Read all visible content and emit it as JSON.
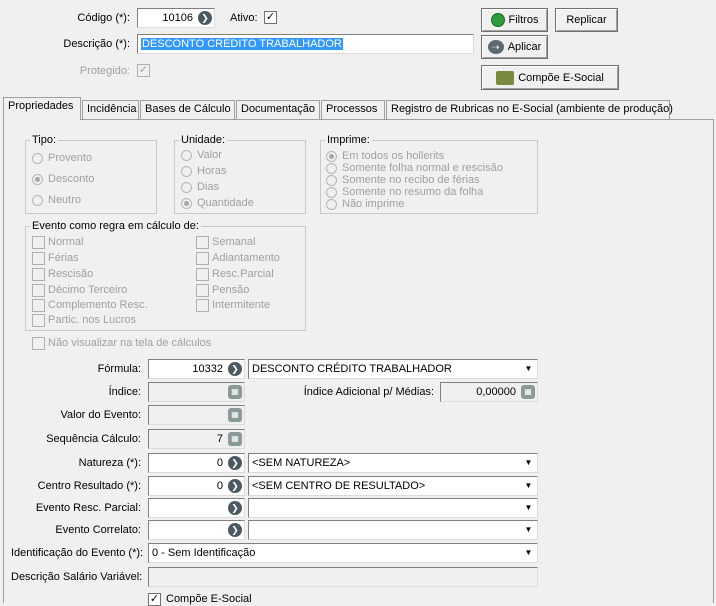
{
  "header": {
    "codigo_label": "Código (*):",
    "codigo_value": "10106",
    "ativo_label": "Ativo:",
    "descricao_label": "Descrição (*):",
    "descricao_value": "DESCONTO CRÉDITO TRABALHADOR",
    "protegido_label": "Protegido:"
  },
  "buttons": {
    "filtros": "Filtros",
    "replicar": "Replicar",
    "aplicar": "Aplicar",
    "compoe_esocial": "Compõe E-Social"
  },
  "tabs": [
    "Propriedades",
    "Incidência",
    "Bases de Cálculo",
    "Documentação",
    "Processos",
    "Registro de Rubricas no E-Social (ambiente de produção)"
  ],
  "tipo": {
    "title": "Tipo:",
    "options": [
      "Provento",
      "Desconto",
      "Neutro"
    ],
    "selected": "Desconto"
  },
  "unidade": {
    "title": "Unidade:",
    "options": [
      "Valor",
      "Horas",
      "Dias",
      "Quantidade"
    ],
    "selected": "Quantidade"
  },
  "imprime": {
    "title": "Imprime:",
    "options": [
      "Em todos os hollerits",
      "Somente folha normal e rescisão",
      "Somente no recibo de férias",
      "Somente no resumo da folha",
      "Não imprime"
    ],
    "selected": "Em todos os hollerits"
  },
  "evento_regra": {
    "title": "Evento como regra em cálculo de:",
    "left": [
      "Normal",
      "Férias",
      "Rescisão",
      "Décimo Terceiro",
      "Complemento Resc.",
      "Partic. nos Lucros"
    ],
    "right": [
      "Semanal",
      "Adiantamento",
      "Resc.Parcial",
      "Pensão",
      "Intermitente"
    ]
  },
  "nao_visualizar_label": "Não visualizar na tela de cálculos",
  "form": {
    "formula_label": "Fórmula:",
    "formula_code": "10332",
    "formula_desc": "DESCONTO CRÉDITO TRABALHADOR",
    "indice_label": "Índice:",
    "indice_value": "",
    "indice_adicional_label": "Índice Adicional p/ Médias:",
    "indice_adicional_value": "0,00000",
    "valor_evento_label": "Valor do Evento:",
    "valor_evento_value": "",
    "sequencia_label": "Sequência Cálculo:",
    "sequencia_value": "7",
    "natureza_label": "Natureza (*):",
    "natureza_code": "0",
    "natureza_desc": "<SEM NATUREZA>",
    "centro_label": "Centro Resultado (*):",
    "centro_code": "0",
    "centro_desc": "<SEM CENTRO DE RESULTADO>",
    "evento_resc_label": "Evento Resc. Parcial:",
    "evento_resc_code": "",
    "evento_resc_desc": "",
    "evento_correlato_label": "Evento Correlato:",
    "evento_correlato_code": "",
    "evento_correlato_desc": "",
    "identificacao_label": "Identificação do Evento (*):",
    "identificacao_value": "0 - Sem Identificação",
    "descricao_salario_label": "Descrição Salário Variável:",
    "descricao_salario_value": "",
    "compoe_esocial_label": "Compõe E-Social"
  }
}
